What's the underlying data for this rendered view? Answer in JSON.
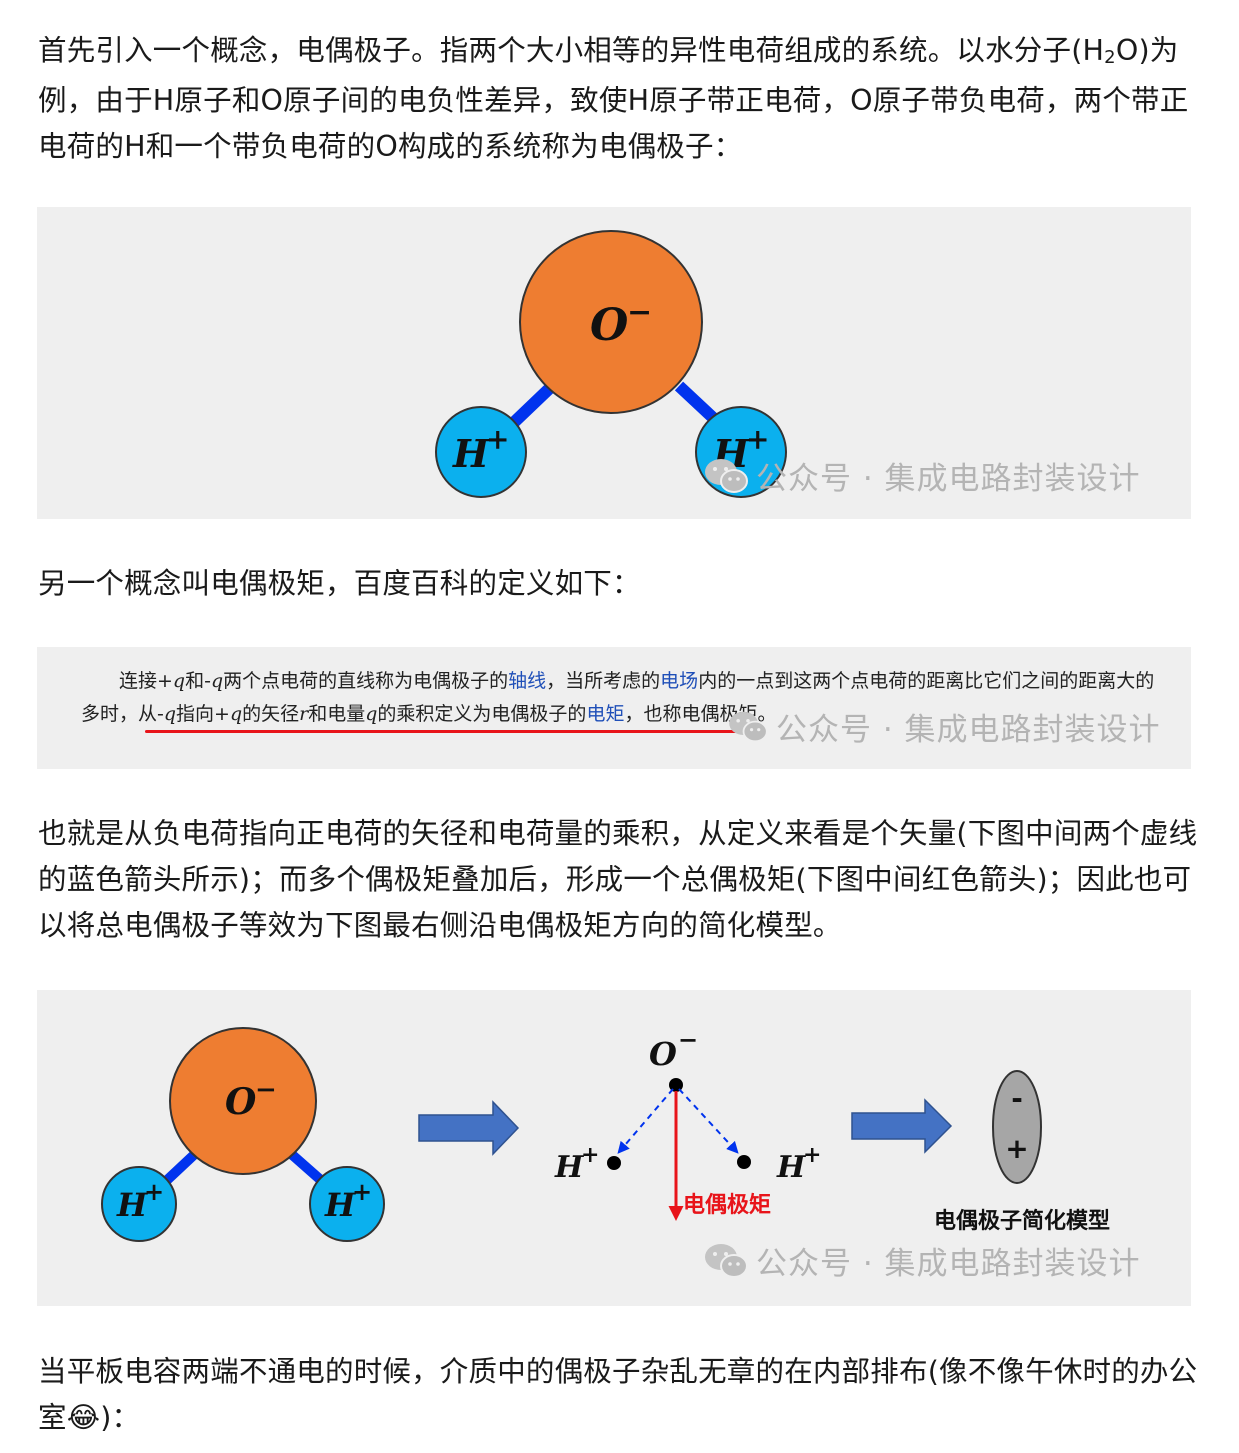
{
  "paragraph1": {
    "text_before_sub": "首先引入一个概念，电偶极子。指两个大小相等的异性电荷组成的系统。以水分子(H",
    "subscript": "2",
    "text_after_sub": "O)为例，由于H原子和O原子间的电负性差异，致使H原子带正电荷，O原子带负电荷，两个带正电荷的H和一个带负电荷的O构成的系统称为电偶极子："
  },
  "figure1": {
    "oxygen_label": "O",
    "oxygen_charge": "−",
    "hydrogen_left_label": "H",
    "hydrogen_left_charge": "+",
    "hydrogen_right_label": "H",
    "hydrogen_right_charge": "+",
    "watermark": "公众号 · 集成电路封装设计"
  },
  "paragraph2": {
    "text": "另一个概念叫电偶极矩，百度百科的定义如下："
  },
  "figure2": {
    "line1_part1": "连接+",
    "line1_q1": "q",
    "line1_part2": "和-",
    "line1_q2": "q",
    "line1_part3": "两个点电荷的直线称为电偶极子的",
    "line1_link1": "轴线",
    "line1_part4": "，当所考虑的",
    "line1_link2": "电场",
    "line1_part5": "内的一点到这两个点电荷的距离比它们之间的距离大的",
    "line2_part1": "多时，从-",
    "line2_q1": "q",
    "line2_part2": "指向+",
    "line2_q2": "q",
    "line2_part3": "的矢径",
    "line2_r": "r",
    "line2_part4": "和电量",
    "line2_q3": "q",
    "line2_part5": "的乘积定义为电偶极子的",
    "line2_link": "电矩",
    "line2_part6": "，也称电偶极矩。",
    "watermark": "公众号 · 集成电路封装设计"
  },
  "paragraph3": {
    "text": "也就是从负电荷指向正电荷的矢径和电荷量的乘积，从定义来看是个矢量(下图中间两个虚线的蓝色箭头所示)；而多个偶极矩叠加后，形成一个总偶极矩(下图中间红色箭头)；因此也可以将总电偶极子等效为下图最右侧沿电偶极矩方向的简化模型。"
  },
  "figure3": {
    "oxygen_label": "O",
    "oxygen_charge": "−",
    "hydrogen_left_label": "H",
    "hydrogen_left_charge": "+",
    "hydrogen_right_label": "H",
    "hydrogen_right_charge": "+",
    "dipole_moment_label": "电偶极矩",
    "model_minus": "-",
    "model_plus": "+",
    "model_caption": "电偶极子简化模型",
    "watermark": "公众号 · 集成电路封装设计"
  },
  "paragraph4": {
    "text": "当平板电容两端不通电的时候，介质中的偶极子杂乱无章的在内部排布(像不像午休时的办公室",
    "emoji": "😂",
    "text_end": ")："
  },
  "colors": {
    "oxygen_fill": "#ee7d31",
    "hydrogen_fill": "#0bb0ee",
    "bond": "#0033ee",
    "arrow_blue": "#4472c4",
    "dipole_red": "#e8141a",
    "figure_bg": "#efefef",
    "link_blue": "#1f4fb8",
    "model_fill": "#a6a6a6"
  }
}
